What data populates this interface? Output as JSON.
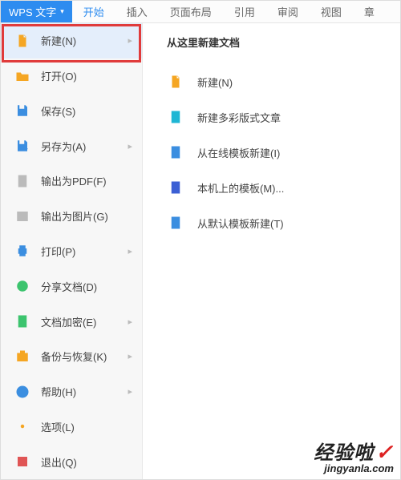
{
  "app": {
    "title": "WPS 文字",
    "caret": "▾"
  },
  "tabs": [
    {
      "label": "开始",
      "active": true
    },
    {
      "label": "插入",
      "active": false
    },
    {
      "label": "页面布局",
      "active": false
    },
    {
      "label": "引用",
      "active": false
    },
    {
      "label": "审阅",
      "active": false
    },
    {
      "label": "视图",
      "active": false
    },
    {
      "label": "章",
      "active": false
    }
  ],
  "menu": [
    {
      "label": "新建(N)",
      "icon": "file-new",
      "hasArrow": true,
      "highlighted": true
    },
    {
      "label": "打开(O)",
      "icon": "folder-open",
      "hasArrow": false
    },
    {
      "label": "保存(S)",
      "icon": "save",
      "hasArrow": false
    },
    {
      "label": "另存为(A)",
      "icon": "save-as",
      "hasArrow": true
    },
    {
      "label": "输出为PDF(F)",
      "icon": "pdf",
      "hasArrow": false
    },
    {
      "label": "输出为图片(G)",
      "icon": "image",
      "hasArrow": false
    },
    {
      "label": "打印(P)",
      "icon": "print",
      "hasArrow": true
    },
    {
      "label": "分享文档(D)",
      "icon": "share",
      "hasArrow": false
    },
    {
      "label": "文档加密(E)",
      "icon": "encrypt",
      "hasArrow": true
    },
    {
      "label": "备份与恢复(K)",
      "icon": "backup",
      "hasArrow": true
    },
    {
      "label": "帮助(H)",
      "icon": "help",
      "hasArrow": true
    },
    {
      "label": "选项(L)",
      "icon": "options",
      "hasArrow": false
    },
    {
      "label": "退出(Q)",
      "icon": "exit",
      "hasArrow": false
    }
  ],
  "submenu": {
    "title": "从这里新建文档",
    "items": [
      {
        "label": "新建(N)",
        "icon": "file-new"
      },
      {
        "label": "新建多彩版式文章",
        "icon": "doc-color"
      },
      {
        "label": "从在线模板新建(I)",
        "icon": "online-template"
      },
      {
        "label": "本机上的模板(M)...",
        "icon": "local-template"
      },
      {
        "label": "从默认模板新建(T)",
        "icon": "default-template"
      }
    ]
  },
  "watermark": {
    "brand": "经验啦",
    "check": "✓",
    "url": "jingyanla.com"
  },
  "arrowGlyph": "▸"
}
